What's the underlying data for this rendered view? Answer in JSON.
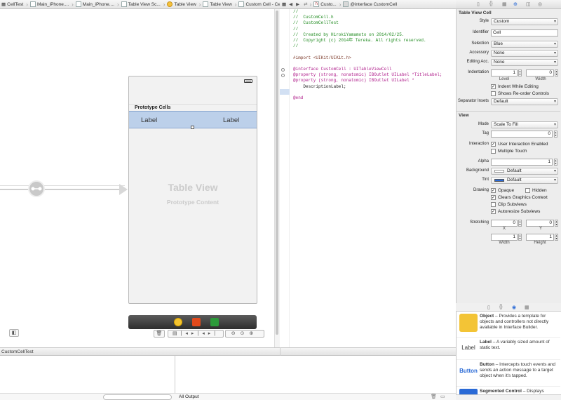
{
  "jumpbar": {
    "crumbs": [
      "CellTest",
      "Main_iPhone....",
      "Main_iPhone....",
      "Table View Sc...",
      "Table View",
      "Table View",
      "Custom Cell - Cell",
      "Custo...",
      "@interface CustomCell"
    ]
  },
  "canvas": {
    "prototype_cells": "Prototype Cells",
    "cell_label_left": "Label",
    "cell_label_right": "Label",
    "table_view": "Table View",
    "prototype_content": "Prototype Content"
  },
  "code": {
    "lines": [
      {
        "cls": "cm",
        "text": "//"
      },
      {
        "cls": "cm",
        "text": "//  CustomCell.h"
      },
      {
        "cls": "cm",
        "text": "//  CustomCellTest"
      },
      {
        "cls": "cm",
        "text": "//"
      },
      {
        "cls": "cm",
        "text": "//  Created by HirokiYamamoto on 2014/02/25."
      },
      {
        "cls": "cm",
        "text": "//  Copyright (c) 2014年 Tereka. All rights reserved."
      },
      {
        "cls": "cm",
        "text": "//"
      },
      {
        "cls": "",
        "text": ""
      },
      {
        "cls": "pp",
        "text": "#import <UIKit/UIKit.h>"
      },
      {
        "cls": "",
        "text": ""
      },
      {
        "cls": "kw",
        "text": "@interface CustomCell : UITableViewCell"
      },
      {
        "cls": "kw",
        "text": "@property (strong, nonatomic) IBOutlet UILabel *TitleLabel;"
      },
      {
        "cls": "kw",
        "text": "@property (strong, nonatomic) IBOutlet UILabel *"
      },
      {
        "cls": "",
        "text": "    DescriptionLabel;"
      },
      {
        "cls": "",
        "text": ""
      },
      {
        "cls": "kw",
        "text": "@end"
      }
    ]
  },
  "inspector": {
    "section_cell": "Table View Cell",
    "style_label": "Style",
    "style_value": "Custom",
    "identifier_label": "Identifier",
    "identifier_value": "Cell",
    "selection_label": "Selection",
    "selection_value": "Blue",
    "accessory_label": "Accessory",
    "accessory_value": "None",
    "editing_acc_label": "Editing Acc.",
    "editing_acc_value": "None",
    "indentation_label": "Indentation",
    "indentation_level": "1",
    "indentation_width": "0",
    "level_label": "Level",
    "width_label": "Width",
    "indent_while_editing": "Indent While Editing",
    "shows_reorder": "Shows Re-order Controls",
    "separator_insets_label": "Separator Insets",
    "separator_insets_value": "Default",
    "section_view": "View",
    "mode_label": "Mode",
    "mode_value": "Scale To Fill",
    "tag_label": "Tag",
    "tag_value": "0",
    "interaction_label": "Interaction",
    "user_interaction": "User Interaction Enabled",
    "multiple_touch": "Multiple Touch",
    "alpha_label": "Alpha",
    "alpha_value": "1",
    "background_label": "Background",
    "background_value": "Default",
    "tint_label": "Tint",
    "tint_value": "Default",
    "drawing_label": "Drawing",
    "opaque": "Opaque",
    "hidden": "Hidden",
    "clears_graphics": "Clears Graphics Context",
    "clip_subviews": "Clip Subviews",
    "autoresize_subviews": "Autoresize Subviews",
    "stretching_label": "Stretching",
    "stretch_x": "0",
    "stretch_y": "0",
    "stretch_w": "1",
    "stretch_h": "1",
    "x_label": "X",
    "y_label": "Y",
    "w_label": "Width",
    "h_label": "Height"
  },
  "library": {
    "items": [
      {
        "title": "Object",
        "desc": " – Provides a template for objects and controllers not directly available in Interface Builder."
      },
      {
        "title": "Label",
        "desc": " – A variably sized amount of static text."
      },
      {
        "title": "Button",
        "desc": " – Intercepts touch events and sends an action message to a target object when it's tapped."
      },
      {
        "title": "Segmented Control",
        "desc": " – Displays"
      }
    ]
  },
  "debug": {
    "target": "CustomCellTest",
    "output_select": "All Output"
  },
  "colors": {
    "cell_highlight": "#bcd0ea",
    "accent_blue": "#2a6ad6"
  }
}
